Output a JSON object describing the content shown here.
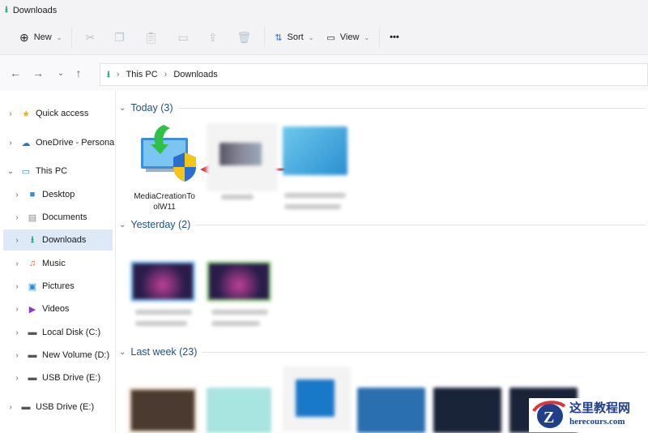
{
  "window": {
    "title": "Downloads"
  },
  "toolbar": {
    "new_label": "New",
    "sort_label": "Sort",
    "view_label": "View",
    "more_label": "•••"
  },
  "address": {
    "crumbs": [
      "This PC",
      "Downloads"
    ]
  },
  "sidebar": {
    "items": [
      {
        "label": "Quick access",
        "icon": "star-icon"
      },
      {
        "label": "OneDrive - Personal",
        "icon": "cloud-icon"
      },
      {
        "label": "This PC",
        "icon": "monitor-icon"
      },
      {
        "label": "Desktop",
        "icon": "desktop-icon"
      },
      {
        "label": "Documents",
        "icon": "documents-icon"
      },
      {
        "label": "Downloads",
        "icon": "download-icon"
      },
      {
        "label": "Music",
        "icon": "music-icon"
      },
      {
        "label": "Pictures",
        "icon": "pictures-icon"
      },
      {
        "label": "Videos",
        "icon": "videos-icon"
      },
      {
        "label": "Local Disk (C:)",
        "icon": "drive-icon"
      },
      {
        "label": "New Volume (D:)",
        "icon": "drive-icon"
      },
      {
        "label": "USB Drive (E:)",
        "icon": "usb-icon"
      },
      {
        "label": "USB Drive (E:)",
        "icon": "usb-icon"
      }
    ]
  },
  "groups": {
    "today": "Today (3)",
    "yesterday": "Yesterday (2)",
    "lastweek": "Last week (23)"
  },
  "files": {
    "media_creation": "MediaCreationTo olW11"
  },
  "watermark": {
    "cn": "这里教程网",
    "url": "herecours.com"
  },
  "colors": {
    "accent": "#1aa36a",
    "selection": "#dde9f7",
    "arrow": "#d9383a"
  }
}
